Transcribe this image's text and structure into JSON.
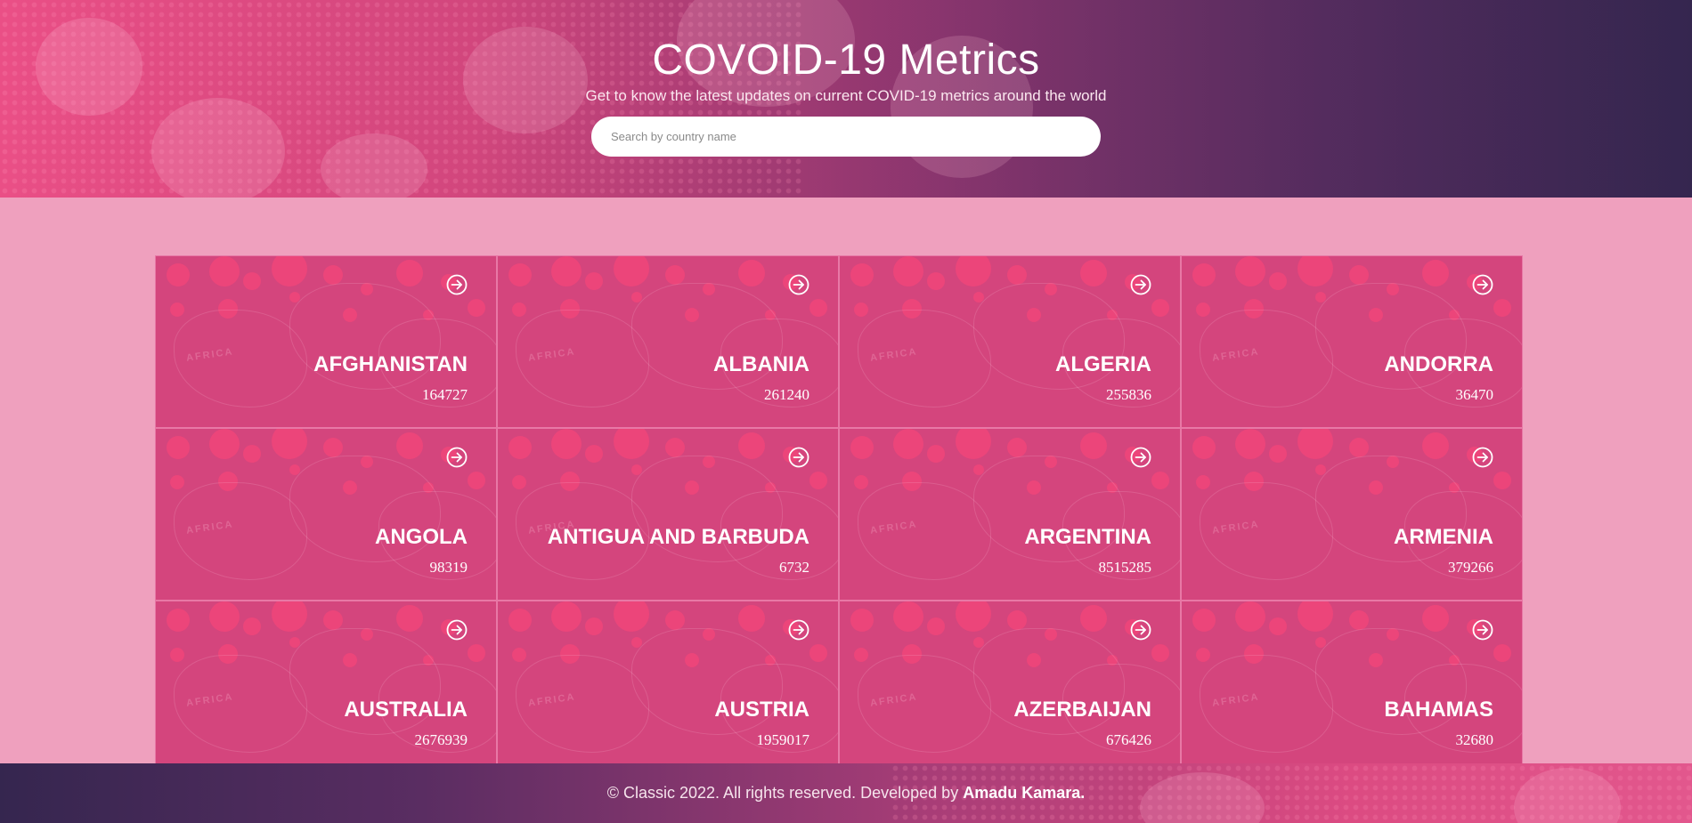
{
  "header": {
    "title": "COVOID-19 Metrics",
    "subtitle": "Get to know the latest updates on current COVID-19 metrics around the world"
  },
  "search": {
    "placeholder": "Search by country name",
    "value": ""
  },
  "card_icon": "arrow-right-circle-icon",
  "card_watermark": "AFRICA",
  "countries": [
    {
      "name": "AFGHANISTAN",
      "count": "164727"
    },
    {
      "name": "ALBANIA",
      "count": "261240"
    },
    {
      "name": "ALGERIA",
      "count": "255836"
    },
    {
      "name": "ANDORRA",
      "count": "36470"
    },
    {
      "name": "ANGOLA",
      "count": "98319"
    },
    {
      "name": "ANTIGUA AND BARBUDA",
      "count": "6732"
    },
    {
      "name": "ARGENTINA",
      "count": "8515285"
    },
    {
      "name": "ARMENIA",
      "count": "379266"
    },
    {
      "name": "AUSTRALIA",
      "count": "2676939"
    },
    {
      "name": "AUSTRIA",
      "count": "1959017"
    },
    {
      "name": "AZERBAIJAN",
      "count": "676426"
    },
    {
      "name": "BAHAMAS",
      "count": "32680"
    }
  ],
  "footer": {
    "text": "© Classic 2022. All rights reserved. Developed by",
    "author": "Amadu Kamara."
  },
  "colors": {
    "page_background": "#efa0be",
    "card_background": "#d4457d",
    "card_border": "#e878a6",
    "hero_start": "#ea4f86",
    "hero_end": "#35264f"
  }
}
